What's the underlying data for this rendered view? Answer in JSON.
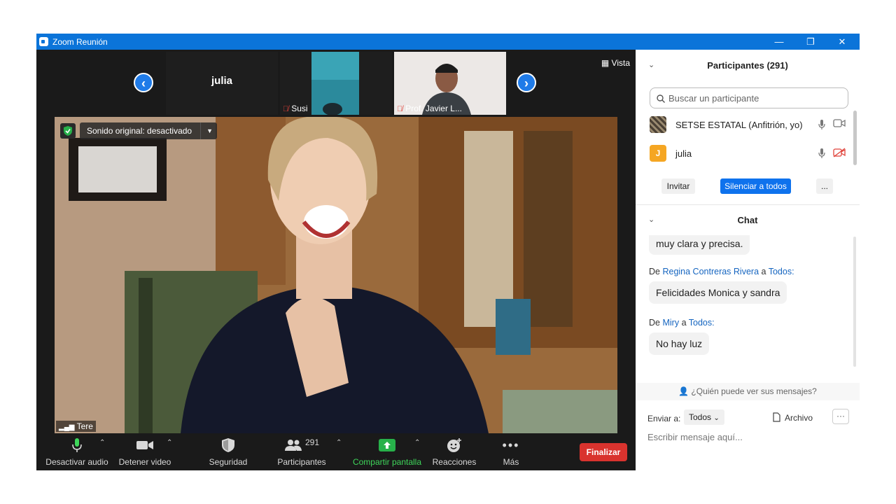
{
  "window": {
    "title": "Zoom Reunión",
    "controls": {
      "minimize": "—",
      "restore": "❐",
      "close": "✕"
    }
  },
  "strip": {
    "prev_icon": "‹",
    "next_icon": "›",
    "view_label": "Vista",
    "thumbs": [
      {
        "name": "julia",
        "muted": false
      },
      {
        "name": "Susi",
        "muted": true
      },
      {
        "name": "Prof. Javier L...",
        "muted": true
      }
    ]
  },
  "video": {
    "sound_label": "Sonido original: desactivado",
    "speaker": "Tere"
  },
  "toolbar": {
    "audio": "Desactivar audio",
    "video": "Detener video",
    "security": "Seguridad",
    "participants": "Participantes",
    "participants_count": "291",
    "share": "Compartir pantalla",
    "reactions": "Reacciones",
    "more": "Más",
    "end": "Finalizar"
  },
  "participants": {
    "title": "Participantes (291)",
    "search_placeholder": "Buscar un participante",
    "list": [
      {
        "name": "SETSE ESTATAL (Anfitrión, yo)",
        "avatar": ""
      },
      {
        "name": "julia",
        "avatar": "J"
      }
    ],
    "invite": "Invitar",
    "mute_all": "Silenciar a todos",
    "more": "..."
  },
  "chat": {
    "title": "Chat",
    "partial_message": "muy clara y precisa.",
    "messages": [
      {
        "prefix": "De",
        "sender": "Regina Contreras Rivera",
        "joiner": "a",
        "to": "Todos:",
        "text": "Felicidades Monica y sandra"
      },
      {
        "prefix": "De",
        "sender": "Miry",
        "joiner": "a",
        "to": "Todos:",
        "text": "No hay luz"
      }
    ],
    "who_can_see": "¿Quién puede ver sus mensajes?",
    "send_to_label": "Enviar a:",
    "send_to_value": "Todos",
    "file_label": "Archivo",
    "input_placeholder": "Escribir mensaje aquí..."
  },
  "colors": {
    "titlebar": "#0b74d9",
    "accent_blue": "#0e72ed",
    "end_red": "#d9332e",
    "share_green": "#3ed65a",
    "dark_bg": "#1a1a1a"
  }
}
